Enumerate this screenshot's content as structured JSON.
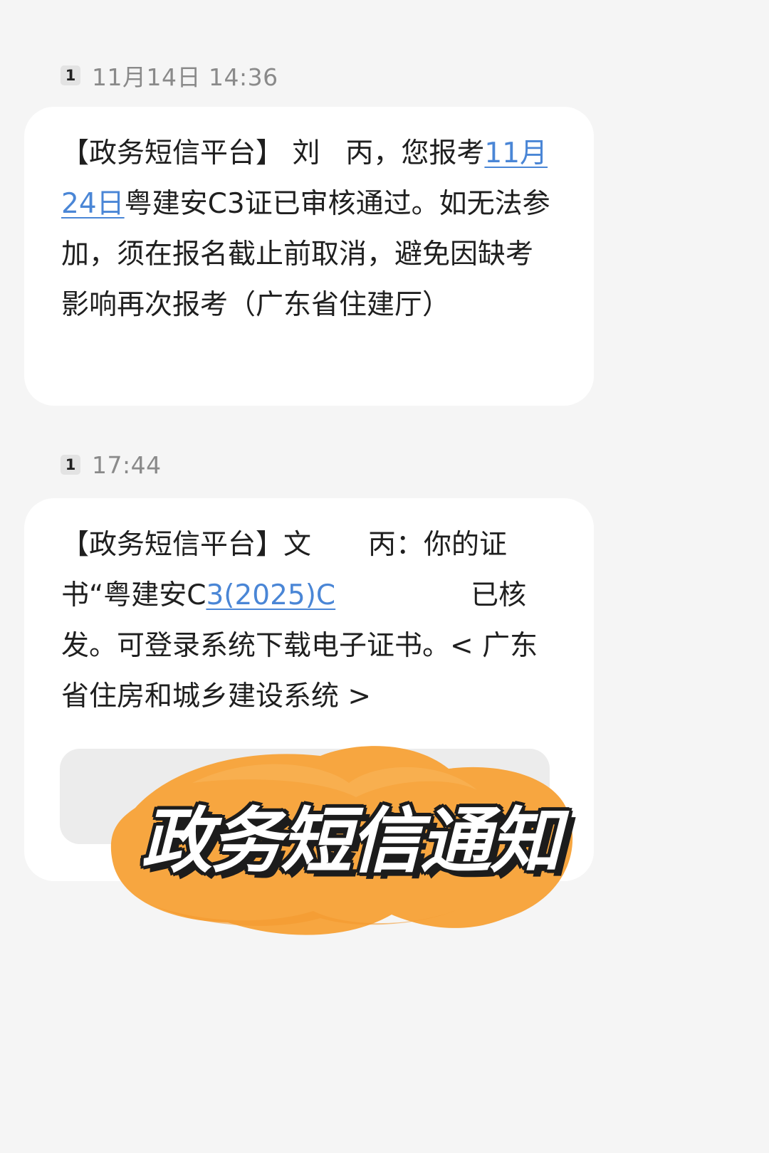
{
  "conversation": {
    "messages": [
      {
        "sim": "1",
        "time": "11月14日 14:36",
        "text_parts": [
          "【政务短信平台】 刘",
          "丙，您报考",
          "11月24日",
          "粤建安C3证已审核通过。如无法参加，须在报名截止前取消，避免因缺考影响再次报考（广东省住建厅）"
        ]
      },
      {
        "sim": "1",
        "time": "17:44",
        "text_parts": [
          "【政务短信平台】文",
          "丙：你的证书“粤建安C",
          "3(2025)C",
          "已核发。可登录系统下载电子证书。< 广东省住房和城乡建设系统 >"
        ]
      }
    ]
  },
  "overlay": {
    "title": "政务短信通知",
    "color": "#f7a640"
  },
  "colors": {
    "background": "#f5f5f5",
    "bubble": "#ffffff",
    "link": "#4a86d6",
    "timestamp": "#8a8a8a"
  }
}
